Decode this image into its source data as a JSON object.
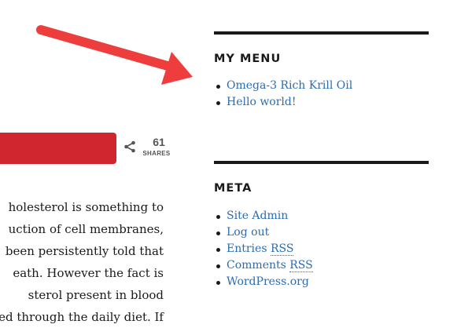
{
  "article": {
    "share_count": "61",
    "share_label": "SHARES",
    "lines": [
      "holesterol is something to",
      "uction of cell membranes,",
      "been persistently told that",
      "eath. However the fact is",
      "sterol present in blood",
      "ed through the daily diet. If"
    ]
  },
  "sidebar": {
    "my_menu": {
      "title": "MY MENU",
      "items": [
        "Omega-3 Rich Krill Oil",
        "Hello world!"
      ]
    },
    "meta": {
      "title": "META",
      "items": [
        {
          "text": "Site Admin"
        },
        {
          "text": "Log out"
        },
        {
          "text": "Entries ",
          "abbr": "RSS"
        },
        {
          "text": "Comments ",
          "abbr": "RSS"
        },
        {
          "text": "WordPress.org"
        }
      ]
    }
  },
  "colors": {
    "share_bar": "#d0262f",
    "arrow": "#ee3d3d",
    "link": "#2b6cb0"
  },
  "icons": [
    "share-icon",
    "arrow-annotation"
  ]
}
